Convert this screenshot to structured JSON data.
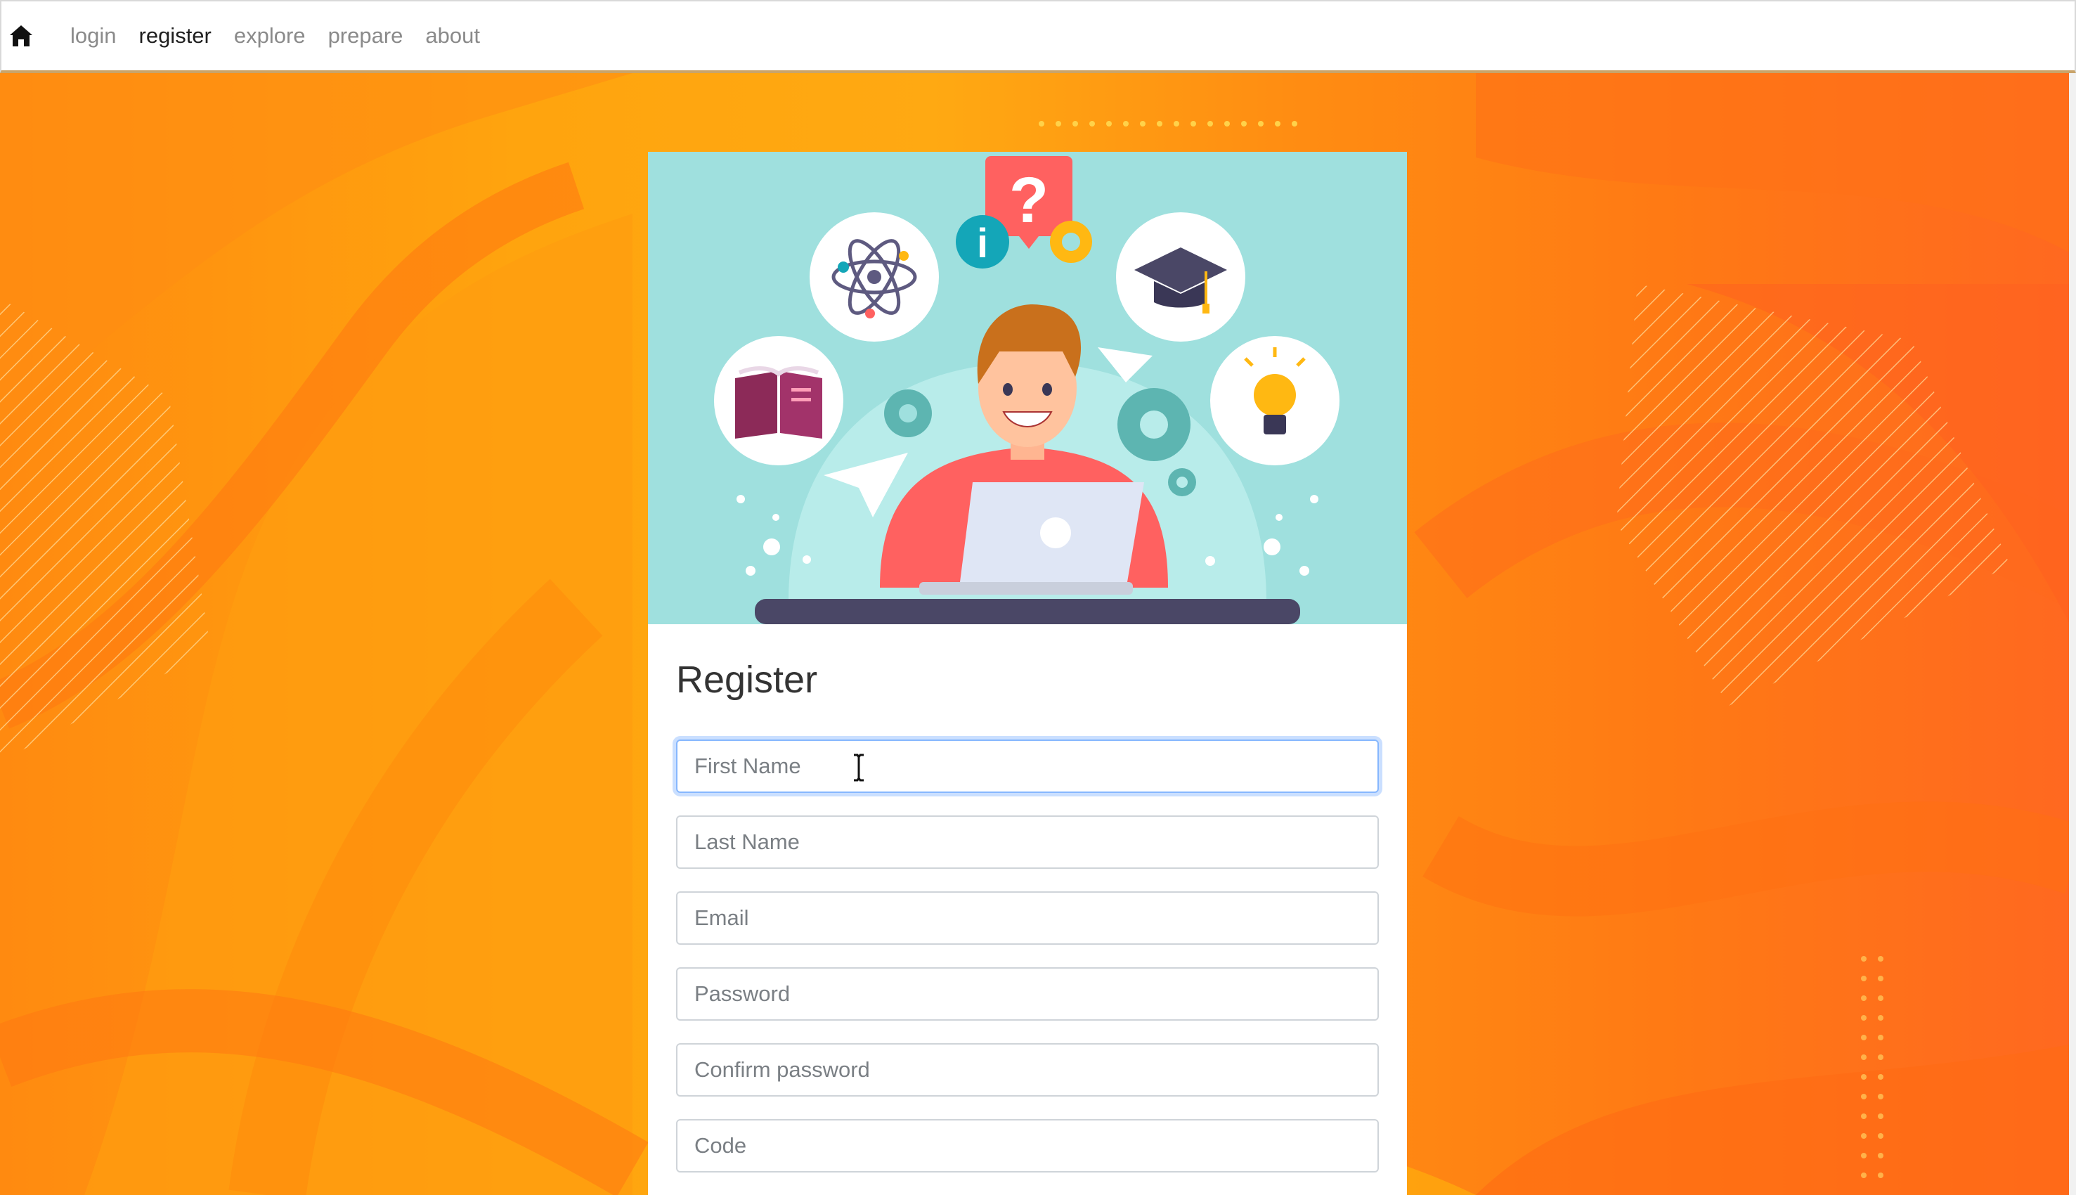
{
  "nav": {
    "home_icon": "home-icon",
    "links": [
      {
        "label": "login",
        "active": false
      },
      {
        "label": "register",
        "active": true
      },
      {
        "label": "explore",
        "active": false
      },
      {
        "label": "prepare",
        "active": false
      },
      {
        "label": "about",
        "active": false
      }
    ]
  },
  "hero": {
    "image": "student-with-laptop-illustration",
    "question_mark": "?",
    "info_mark": "i"
  },
  "form": {
    "title": "Register",
    "fields": [
      {
        "placeholder": "First Name",
        "value": "",
        "focused": true
      },
      {
        "placeholder": "Last Name",
        "value": "",
        "focused": false
      },
      {
        "placeholder": "Email",
        "value": "",
        "focused": false
      },
      {
        "placeholder": "Password",
        "value": "",
        "focused": false
      },
      {
        "placeholder": "Confirm password",
        "value": "",
        "focused": false
      },
      {
        "placeholder": "Code",
        "value": "",
        "focused": false
      }
    ]
  },
  "colors": {
    "accent_orange": "#ff9a10",
    "hero_teal": "#9fe0de",
    "focus_blue": "#86b7fe"
  }
}
